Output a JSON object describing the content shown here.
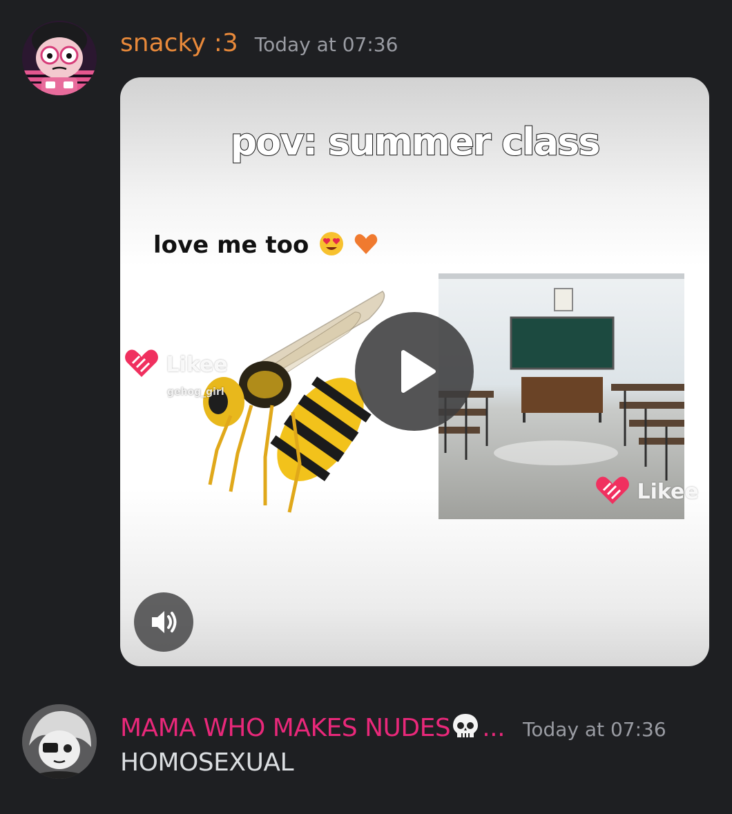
{
  "messages": [
    {
      "username": "snacky :3",
      "timestamp": "Today at 07:36",
      "username_color": "#e8893a",
      "attachment": {
        "type": "video",
        "caption_title": "pov: summer class",
        "caption_sub": "love me too",
        "caption_emojis": [
          "heart-eyes-emoji",
          "orange-heart-emoji"
        ],
        "watermark_left": "Likee",
        "watermark_left_user": "gehog_girl",
        "watermark_right": "Likee",
        "controls": [
          "play-icon",
          "volume-icon"
        ]
      }
    },
    {
      "username": "MAMA WHO MAKES NUDES",
      "username_suffix": "...",
      "username_emoji": "skull-emoji",
      "timestamp": "Today at 07:36",
      "username_color": "#e9287a",
      "text": "HOMOSEXUAL"
    }
  ],
  "colors": {
    "background": "#1e1f22",
    "timestamp": "#9a9ca3",
    "message_text": "#dbdee1"
  }
}
